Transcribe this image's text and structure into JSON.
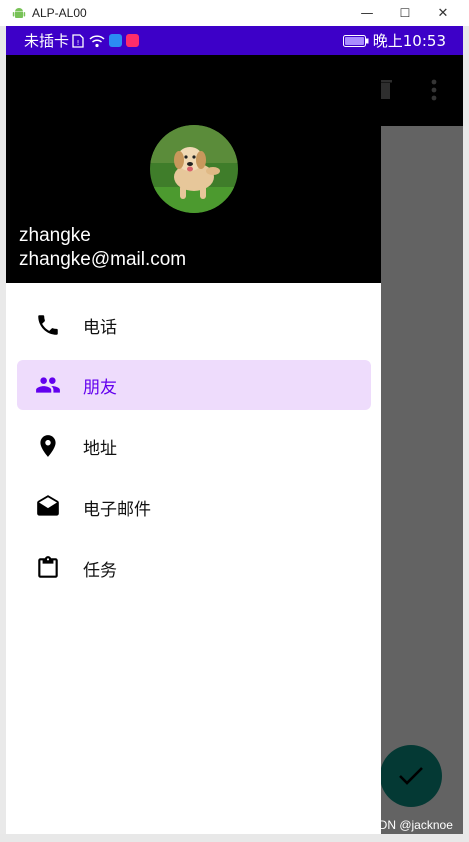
{
  "window": {
    "title": "ALP-AL00",
    "minimize": "—",
    "maximize": "☐",
    "close": "✕"
  },
  "statusbar": {
    "carrier": "未插卡",
    "time": "晚上10:53"
  },
  "drawer": {
    "header": {
      "name": "zhangke",
      "email": "zhangke@mail.com"
    },
    "items": [
      {
        "label": "电话",
        "icon": "phone-icon",
        "selected": false
      },
      {
        "label": "朋友",
        "icon": "people-icon",
        "selected": true
      },
      {
        "label": "地址",
        "icon": "location-pin-icon",
        "selected": false
      },
      {
        "label": "电子邮件",
        "icon": "email-icon",
        "selected": false
      },
      {
        "label": "任务",
        "icon": "clipboard-icon",
        "selected": false
      }
    ]
  },
  "watermark": "CSDN @jacknoe",
  "colors": {
    "statusbar": "#3d00c8",
    "accent": "#6200ee",
    "selected_bg": "#eedcfc",
    "fab": "#0b7e74"
  }
}
